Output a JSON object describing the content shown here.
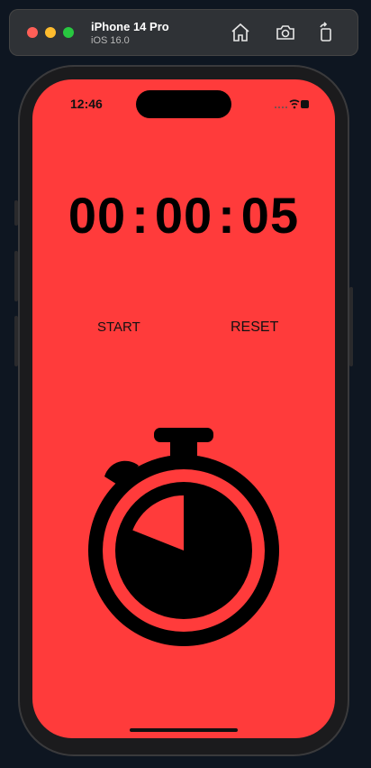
{
  "simulator": {
    "device_name": "iPhone 14 Pro",
    "os_version": "iOS 16.0"
  },
  "status_bar": {
    "time": "12:46"
  },
  "timer": {
    "hours": "00",
    "minutes": "00",
    "seconds": "05",
    "separator": ":"
  },
  "controls": {
    "start_label": "START",
    "reset_label": "RESET"
  },
  "stopwatch_icon": {
    "progress_fraction": 0.19
  },
  "colors": {
    "screen_background": "#ff3b3b",
    "foreground": "#000000"
  }
}
